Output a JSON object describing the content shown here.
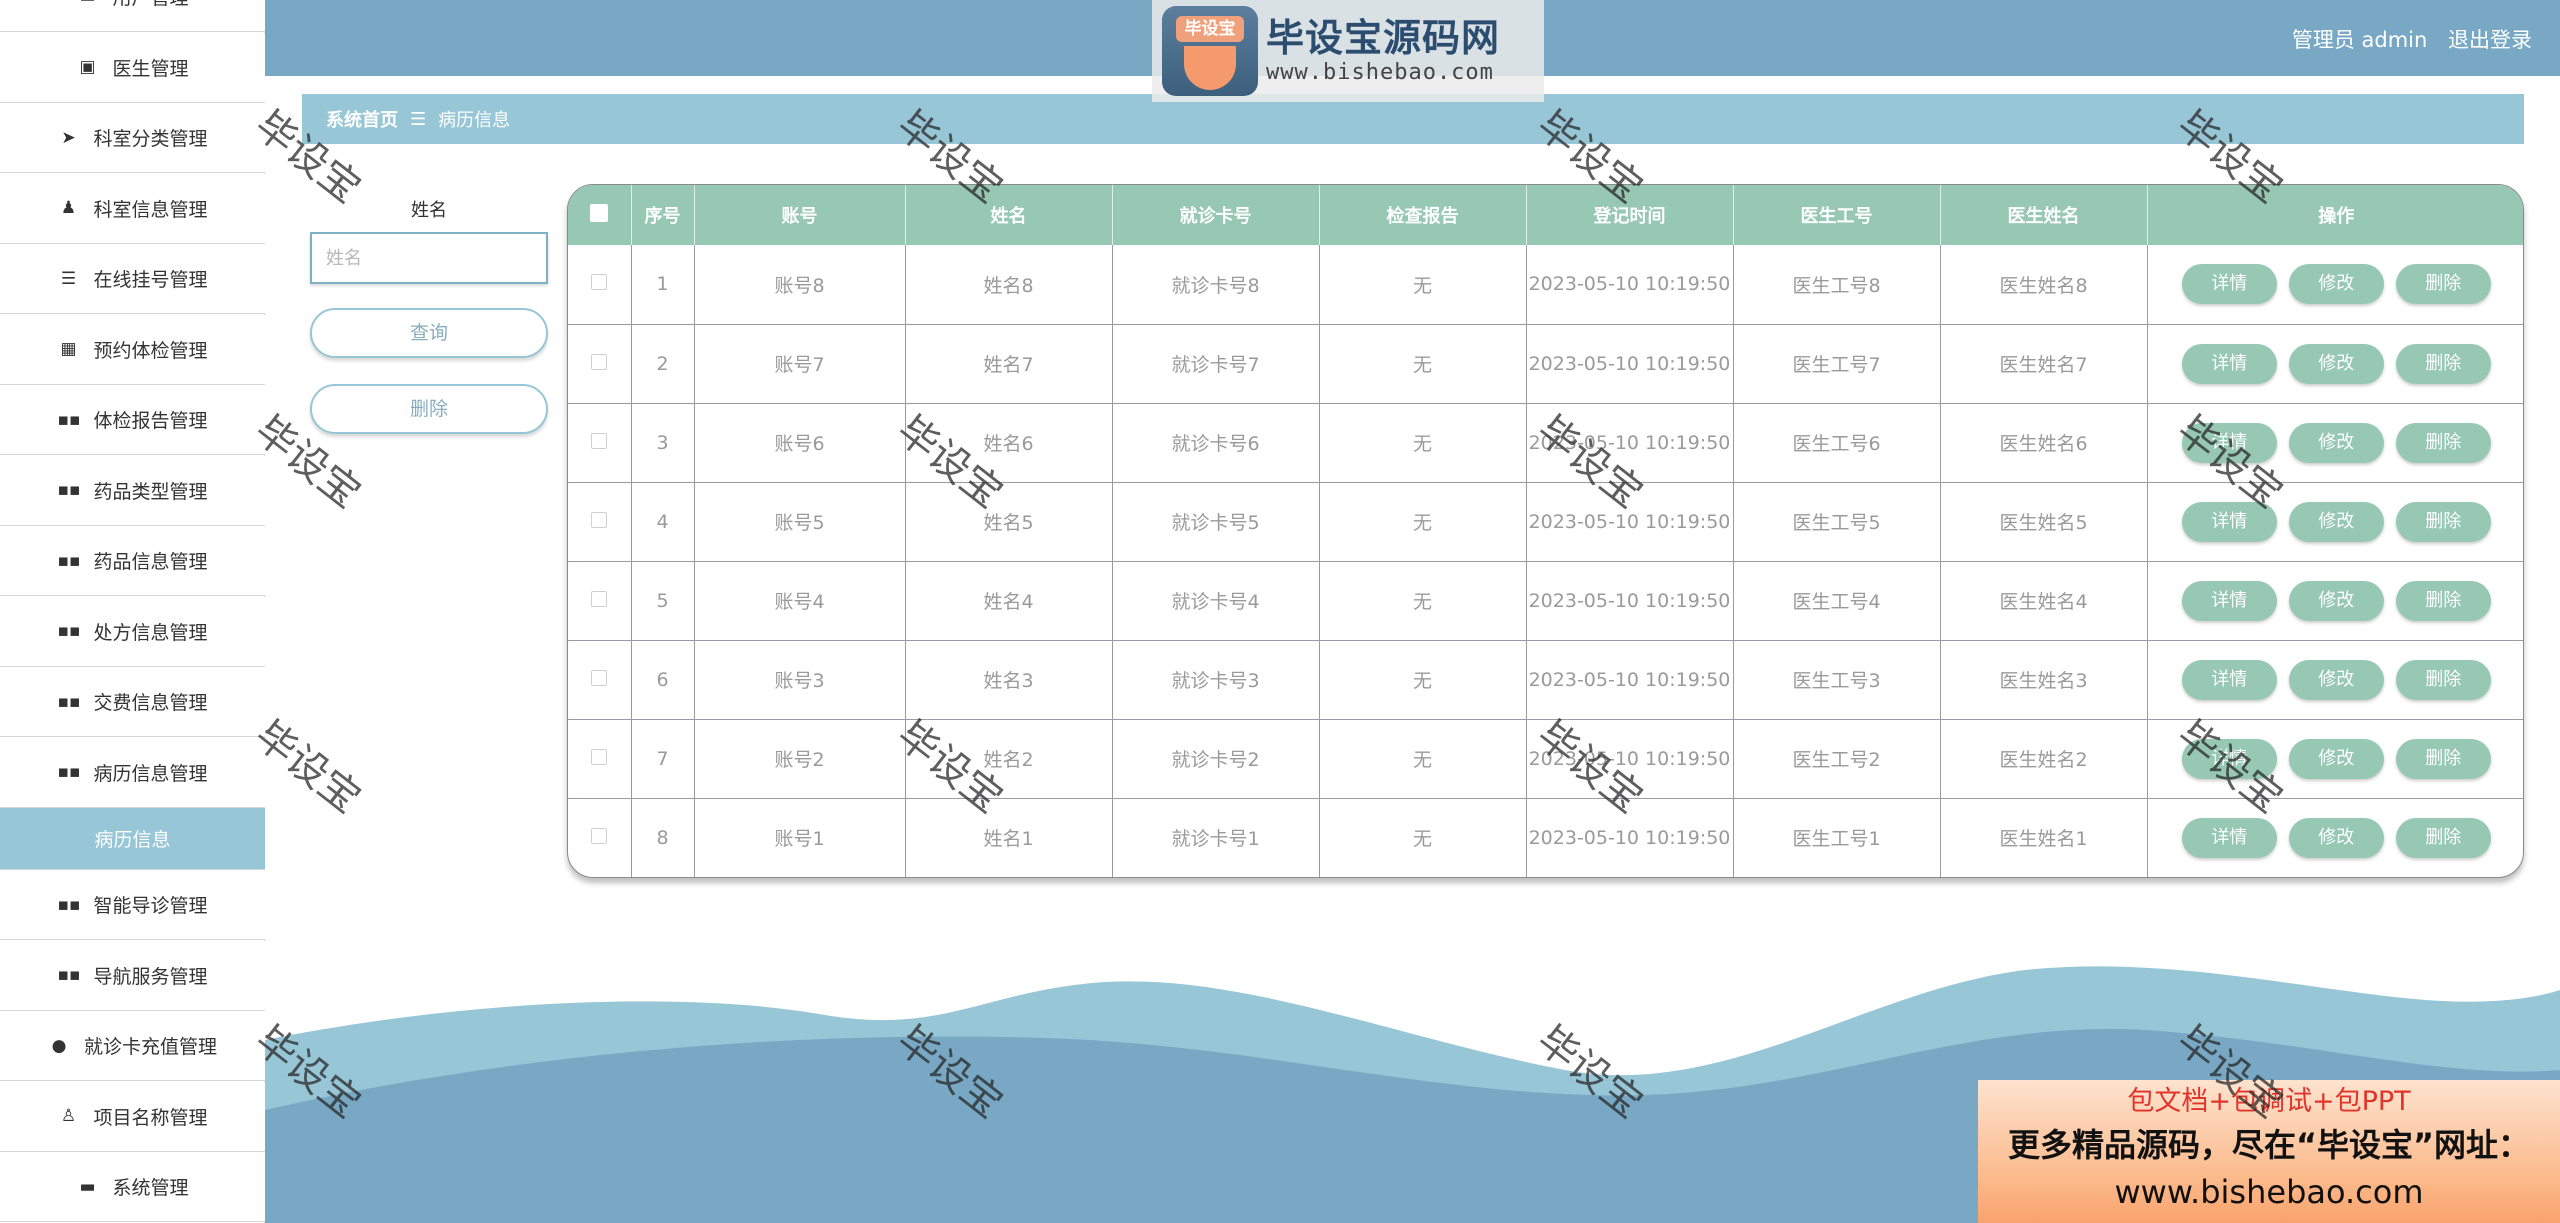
{
  "header": {
    "logo_badge": "毕设宝",
    "logo_title": "毕设宝源码网",
    "logo_url": "www.bishebao.com",
    "user_label": "管理员 admin",
    "logout_label": "退出登录",
    "bg_color": "#78a8c4"
  },
  "sidebar": {
    "items": [
      {
        "label": "用户管理",
        "icon": "card-icon",
        "glyph": "▬"
      },
      {
        "label": "医生管理",
        "icon": "clipboard-icon",
        "glyph": "▣"
      },
      {
        "label": "科室分类管理",
        "icon": "paper-plane-icon",
        "glyph": "➤"
      },
      {
        "label": "科室信息管理",
        "icon": "stamp-icon",
        "glyph": "♟"
      },
      {
        "label": "在线挂号管理",
        "icon": "sliders-icon",
        "glyph": "☰"
      },
      {
        "label": "预约体检管理",
        "icon": "grid-icon",
        "glyph": "▦"
      },
      {
        "label": "体检报告管理",
        "icon": "apps-icon",
        "glyph": "▪▪"
      },
      {
        "label": "药品类型管理",
        "icon": "apps-icon",
        "glyph": "▪▪"
      },
      {
        "label": "药品信息管理",
        "icon": "apps-icon",
        "glyph": "▪▪"
      },
      {
        "label": "处方信息管理",
        "icon": "apps-icon",
        "glyph": "▪▪"
      },
      {
        "label": "交费信息管理",
        "icon": "apps-icon",
        "glyph": "▪▪"
      },
      {
        "label": "病历信息管理",
        "icon": "apps-icon",
        "glyph": "▪▪"
      },
      {
        "label": "病历信息",
        "icon": "",
        "glyph": "",
        "active": true
      },
      {
        "label": "智能导诊管理",
        "icon": "apps-icon",
        "glyph": "▪▪"
      },
      {
        "label": "导航服务管理",
        "icon": "apps-icon",
        "glyph": "▪▪"
      },
      {
        "label": "就诊卡充值管理",
        "icon": "lightbulb-icon",
        "glyph": "●"
      },
      {
        "label": "项目名称管理",
        "icon": "user-icon",
        "glyph": "♙"
      },
      {
        "label": "系统管理",
        "icon": "printer-icon",
        "glyph": "▬"
      }
    ],
    "active_color": "#97c6d6"
  },
  "breadcrumb": {
    "home": "系统首页",
    "separator": "☰",
    "current": "病历信息"
  },
  "search": {
    "label": "姓名",
    "placeholder": "姓名",
    "query_button": "查询",
    "delete_button": "删除"
  },
  "table": {
    "header_color": "#96c8b4",
    "columns": [
      "序号",
      "账号",
      "姓名",
      "就诊卡号",
      "检查报告",
      "登记时间",
      "医生工号",
      "医生姓名",
      "操作"
    ],
    "actions": [
      "详情",
      "修改",
      "删除"
    ],
    "rows": [
      {
        "index": "1",
        "account": "账号8",
        "name": "姓名8",
        "card": "就诊卡号8",
        "report": "无",
        "time": "2023-05-10 10:19:50",
        "doctor_id": "医生工号8",
        "doctor_name": "医生姓名8"
      },
      {
        "index": "2",
        "account": "账号7",
        "name": "姓名7",
        "card": "就诊卡号7",
        "report": "无",
        "time": "2023-05-10 10:19:50",
        "doctor_id": "医生工号7",
        "doctor_name": "医生姓名7"
      },
      {
        "index": "3",
        "account": "账号6",
        "name": "姓名6",
        "card": "就诊卡号6",
        "report": "无",
        "time": "2023-05-10 10:19:50",
        "doctor_id": "医生工号6",
        "doctor_name": "医生姓名6"
      },
      {
        "index": "4",
        "account": "账号5",
        "name": "姓名5",
        "card": "就诊卡号5",
        "report": "无",
        "time": "2023-05-10 10:19:50",
        "doctor_id": "医生工号5",
        "doctor_name": "医生姓名5"
      },
      {
        "index": "5",
        "account": "账号4",
        "name": "姓名4",
        "card": "就诊卡号4",
        "report": "无",
        "time": "2023-05-10 10:19:50",
        "doctor_id": "医生工号4",
        "doctor_name": "医生姓名4"
      },
      {
        "index": "6",
        "account": "账号3",
        "name": "姓名3",
        "card": "就诊卡号3",
        "report": "无",
        "time": "2023-05-10 10:19:50",
        "doctor_id": "医生工号3",
        "doctor_name": "医生姓名3"
      },
      {
        "index": "7",
        "account": "账号2",
        "name": "姓名2",
        "card": "就诊卡号2",
        "report": "无",
        "time": "2023-05-10 10:19:50",
        "doctor_id": "医生工号2",
        "doctor_name": "医生姓名2"
      },
      {
        "index": "8",
        "account": "账号1",
        "name": "姓名1",
        "card": "就诊卡号1",
        "report": "无",
        "time": "2023-05-10 10:19:50",
        "doctor_id": "医生工号1",
        "doctor_name": "医生姓名1"
      }
    ]
  },
  "watermark": {
    "text": "毕设宝"
  },
  "promo": {
    "line1": "包文档+包调试+包PPT",
    "line2": "更多精品源码，尽在“毕设宝”网址：",
    "line3": "www.bishebao.com"
  }
}
